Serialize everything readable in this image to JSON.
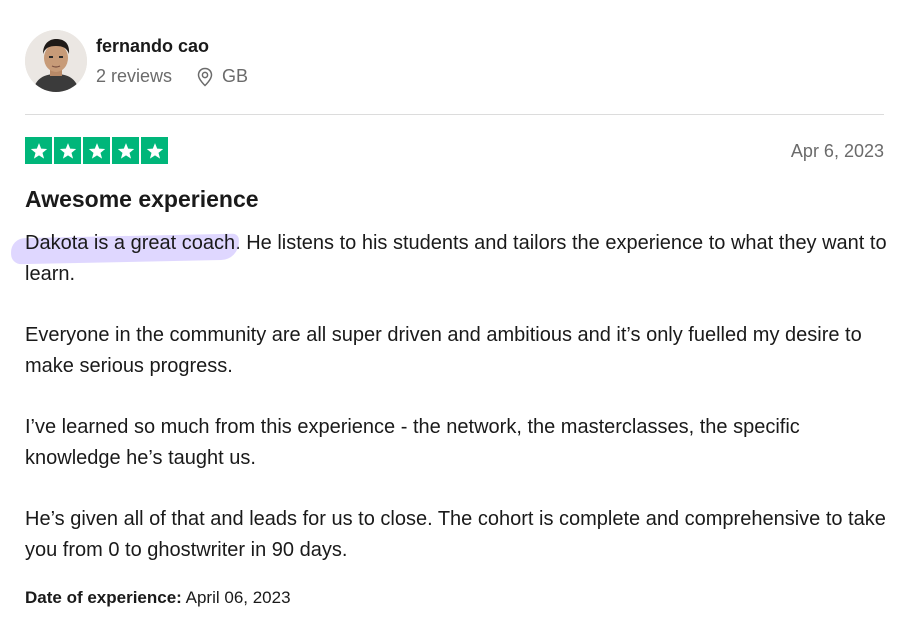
{
  "reviewer": {
    "name": "fernando cao",
    "reviews_count": "2 reviews",
    "country": "GB",
    "avatar_icon": "person-avatar-photo",
    "location_icon": "location-pin-icon"
  },
  "review": {
    "rating": 5,
    "max_rating": 5,
    "star_color": "#00b67a",
    "highlight_color": "#c4b6ff",
    "date": "Apr 6, 2023",
    "title": "Awesome experience",
    "paragraphs": [
      {
        "highlighted": "Dakota is a great coach",
        "rest": ". He listens to his students and tailors the experience to what they want to learn."
      },
      {
        "text": "Everyone in the community are all super driven and ambitious and it’s only fuelled my desire to make serious progress."
      },
      {
        "text": "I’ve learned so much from this experience - the network, the masterclasses, the specific knowledge he’s taught us."
      },
      {
        "text": "He’s given all of that and leads for us to close. The cohort is complete and comprehensive to take you from 0 to ghostwriter in 90 days."
      }
    ],
    "experience_label": "Date of experience:",
    "experience_date": "April 06, 2023"
  }
}
